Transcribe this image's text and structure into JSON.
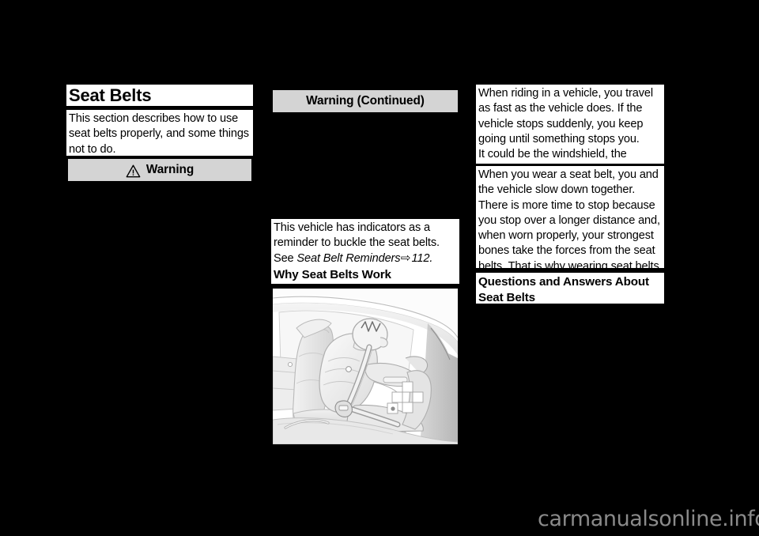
{
  "page": {
    "background_color": "#000000",
    "paper_color": "#ffffff",
    "warning_bar_color": "#d4d4d4",
    "watermark": "carmanualsonline.info",
    "watermark_color": "#8a8a8a"
  },
  "left_column": {
    "title": "Seat Belts",
    "intro": "This section describes how to use seat belts properly, and some things not to do.",
    "warning_header": {
      "icon": "warning-triangle-icon",
      "label": "Warning"
    }
  },
  "middle_column": {
    "warning_continued_header": {
      "label": "Warning  (Continued)"
    },
    "reminder_text": {
      "lead": "This vehicle has indicators as a reminder to buckle the seat belts. See ",
      "xref_title": "Seat Belt Reminders",
      "xref_arrow": "⇨",
      "xref_page": "112",
      "trailing": "."
    },
    "section_heading": "Why Seat Belts Work",
    "figure": {
      "name": "seat-belt-occupant-illustration",
      "caption": "Line drawing of a crash test dummy seated in a vehicle seat wearing a seat belt"
    }
  },
  "right_column": {
    "paragraph_1": "When riding in a vehicle, you travel as fast as the vehicle does. If the vehicle stops suddenly, you keep going until something stops you.\nIt could be the windshield, the instrument panel, or the seat belts!",
    "paragraph_2": "When you wear a seat belt, you and the vehicle slow down together.\nThere is more time to stop because you stop over a longer distance and, when worn properly, your strongest bones take the forces from the seat belts. That is why wearing seat belts makes such good sense.",
    "section_heading": "Questions and Answers About Seat Belts"
  }
}
